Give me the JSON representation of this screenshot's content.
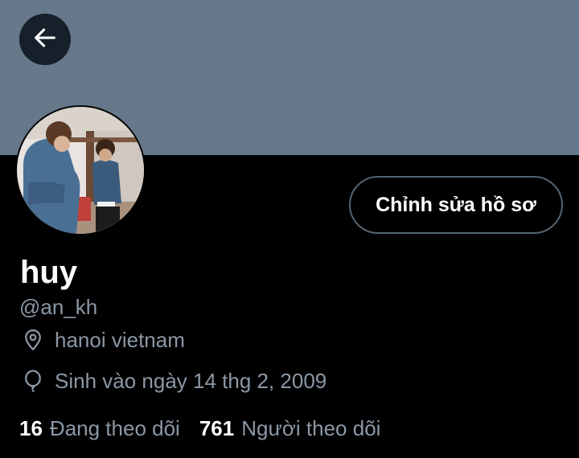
{
  "header": {
    "back_icon": "arrow-left-icon",
    "banner_color": "#66788a"
  },
  "profile": {
    "edit_label": "Chỉnh sửa hồ sơ",
    "name": "huy",
    "handle": "@an_kh",
    "location_icon": "location-pin-icon",
    "location": "hanoi vietnam",
    "birth_icon": "balloon-icon",
    "birth": "Sinh vào ngày 14 thg 2, 2009"
  },
  "stats": {
    "following_count": "16",
    "following_label": "Đang theo dõi",
    "followers_count": "761",
    "followers_label": "Người theo dõi"
  }
}
